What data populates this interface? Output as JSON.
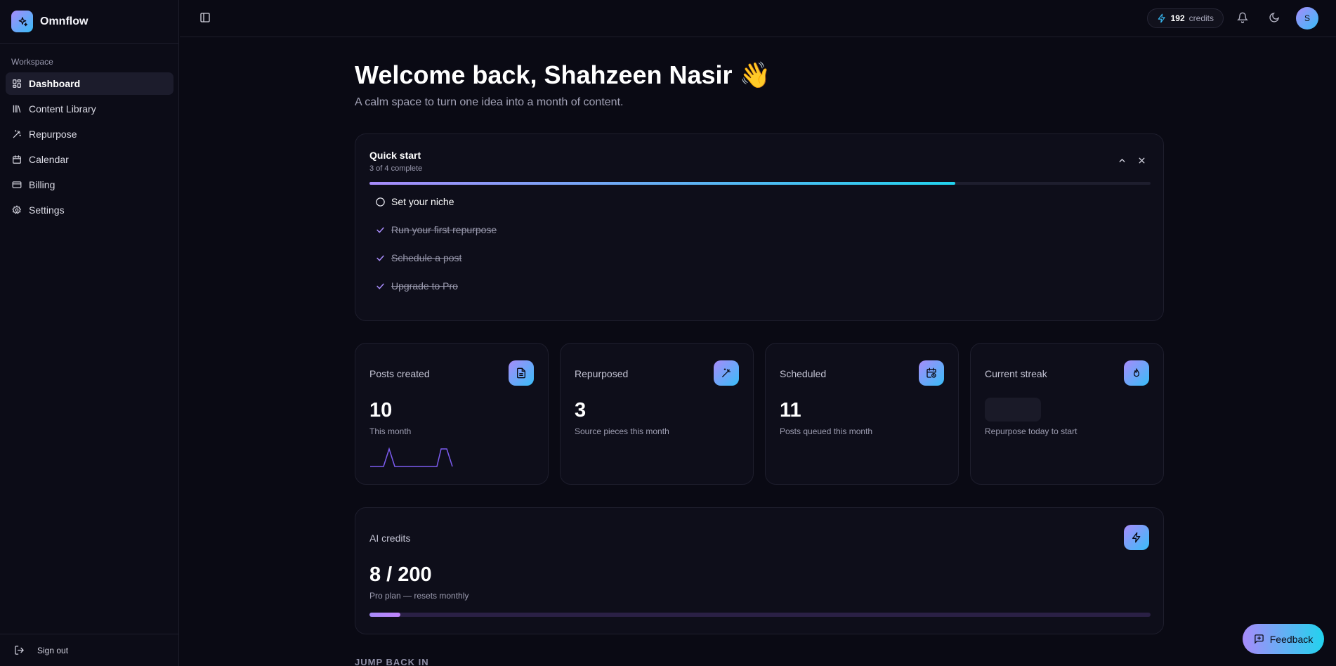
{
  "app": {
    "name": "Omnflow"
  },
  "sidebar": {
    "section_label": "Workspace",
    "items": [
      {
        "label": "Dashboard",
        "icon": "dashboard-icon",
        "active": true
      },
      {
        "label": "Content Library",
        "icon": "library-icon"
      },
      {
        "label": "Repurpose",
        "icon": "magic-wand-icon"
      },
      {
        "label": "Calendar",
        "icon": "calendar-icon"
      },
      {
        "label": "Billing",
        "icon": "credit-card-icon"
      },
      {
        "label": "Settings",
        "icon": "gear-icon"
      }
    ],
    "sign_out": "Sign out"
  },
  "topbar": {
    "credits_value": "192",
    "credits_label": "credits",
    "avatar_initial": "S"
  },
  "welcome": {
    "title": "Welcome back, Shahzeen Nasir 👋",
    "subtitle": "A calm space to turn one idea into a month of content."
  },
  "quick_start": {
    "title": "Quick start",
    "progress_text": "3 of 4 complete",
    "progress_fraction": 0.75,
    "tasks": [
      {
        "label": "Set your niche",
        "done": false
      },
      {
        "label": "Run your first repurpose",
        "done": true
      },
      {
        "label": "Schedule a post",
        "done": true
      },
      {
        "label": "Upgrade to Pro",
        "done": true
      }
    ]
  },
  "stats": [
    {
      "label": "Posts created",
      "value": "10",
      "desc": "This month",
      "icon": "document-icon"
    },
    {
      "label": "Repurposed",
      "value": "3",
      "desc": "Source pieces this month",
      "icon": "magic-wand-icon"
    },
    {
      "label": "Scheduled",
      "value": "11",
      "desc": "Posts queued this month",
      "icon": "calendar-clock-icon"
    },
    {
      "label": "Current streak",
      "value": "",
      "desc": "Repurpose today to start",
      "icon": "flame-icon"
    }
  ],
  "ai_credits": {
    "label": "AI credits",
    "value": "8 / 200",
    "desc": "Pro plan — resets monthly",
    "used_fraction": 0.04,
    "icon": "lightning-icon"
  },
  "jump_back": "JUMP BACK IN",
  "feedback": {
    "label": "Feedback"
  },
  "colors": {
    "accent_start": "#a78bfa",
    "accent_end": "#22d3ee",
    "background": "#0a0a14"
  }
}
